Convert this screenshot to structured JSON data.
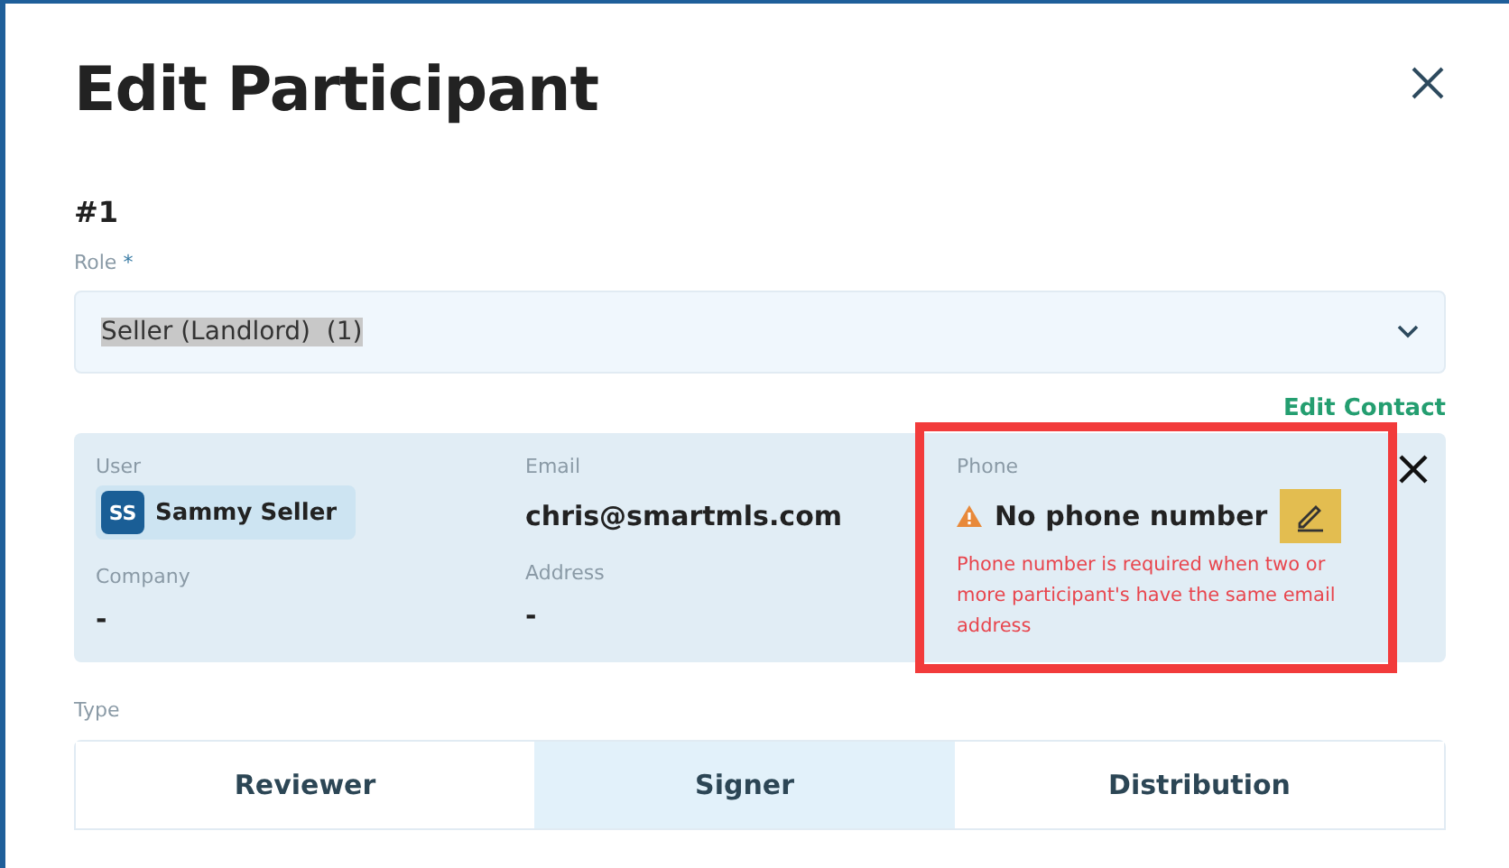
{
  "dialog": {
    "title": "Edit Participant",
    "number": "#1"
  },
  "role": {
    "label": "Role",
    "required_mark": "*",
    "value": "Seller (Landlord)  (1)"
  },
  "edit_contact": "Edit Contact",
  "contact": {
    "user_label": "User",
    "user_initials": "SS",
    "user_name": "Sammy Seller",
    "email_label": "Email",
    "email": "chris@smartmls.com",
    "company_label": "Company",
    "company": "-",
    "address_label": "Address",
    "address": "-",
    "phone_label": "Phone",
    "phone": "No phone number",
    "phone_error": "Phone number is required when two or more participant's have the same email address"
  },
  "type": {
    "label": "Type",
    "options": [
      {
        "label": "Reviewer",
        "selected": false
      },
      {
        "label": "Signer",
        "selected": true
      },
      {
        "label": "Distribution",
        "selected": false
      }
    ]
  }
}
